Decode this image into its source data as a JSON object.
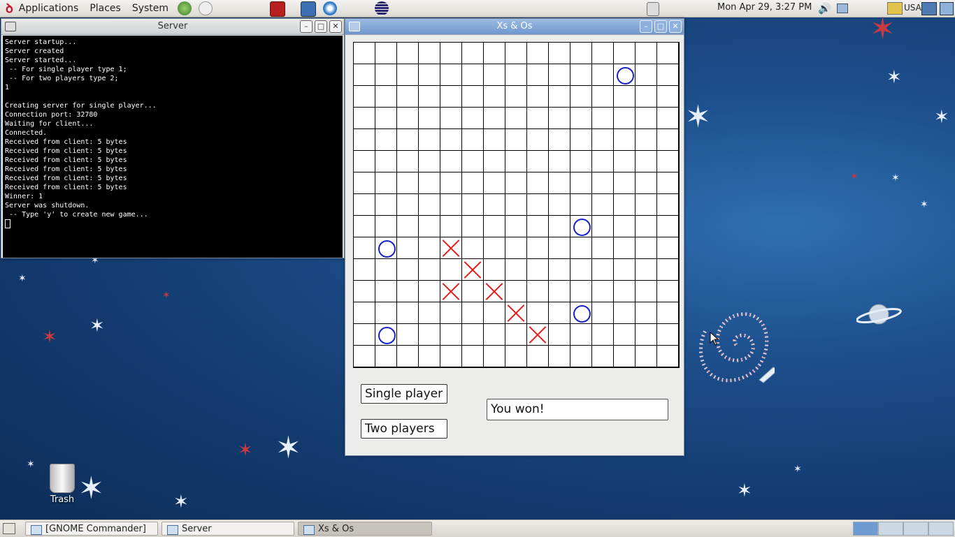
{
  "top_panel": {
    "menus": [
      "Applications",
      "Places",
      "System"
    ],
    "clock": "Mon Apr 29,  3:27 PM",
    "keyboard_layout": "USA"
  },
  "server_window": {
    "title": "Server",
    "terminal_text": "Server startup...\nServer created\nServer started...\n -- For single player type 1;\n -- For two players type 2;\n1\n\nCreating server for single player...\nConnection port: 32780\nWaiting for client...\nConnected.\nReceived from client: 5 bytes\nReceived from client: 5 bytes\nReceived from client: 5 bytes\nReceived from client: 5 bytes\nReceived from client: 5 bytes\nReceived from client: 5 bytes\nWinner: 1\nServer was shutdown.\n -- Type 'y' to create new game..."
  },
  "game_window": {
    "title": "Xs & Os",
    "board": {
      "rows": 15,
      "cols": 15,
      "o_cells": [
        [
          1,
          12
        ],
        [
          8,
          10
        ],
        [
          9,
          1
        ],
        [
          12,
          10
        ],
        [
          13,
          1
        ]
      ],
      "x_cells": [
        [
          9,
          4
        ],
        [
          10,
          5
        ],
        [
          11,
          4
        ],
        [
          11,
          6
        ],
        [
          12,
          7
        ],
        [
          13,
          8
        ]
      ]
    },
    "single_player_label": "Single player",
    "two_players_label": "Two players",
    "status": "You won!"
  },
  "desktop": {
    "trash_label": "Trash"
  },
  "taskbar": {
    "tasks": [
      "[GNOME Commander]",
      "Server",
      "Xs & Os"
    ]
  },
  "colors": {
    "o_mark": "#1a22cc",
    "x_mark": "#e31b1b",
    "active_titlebar": "#6e98cf"
  }
}
